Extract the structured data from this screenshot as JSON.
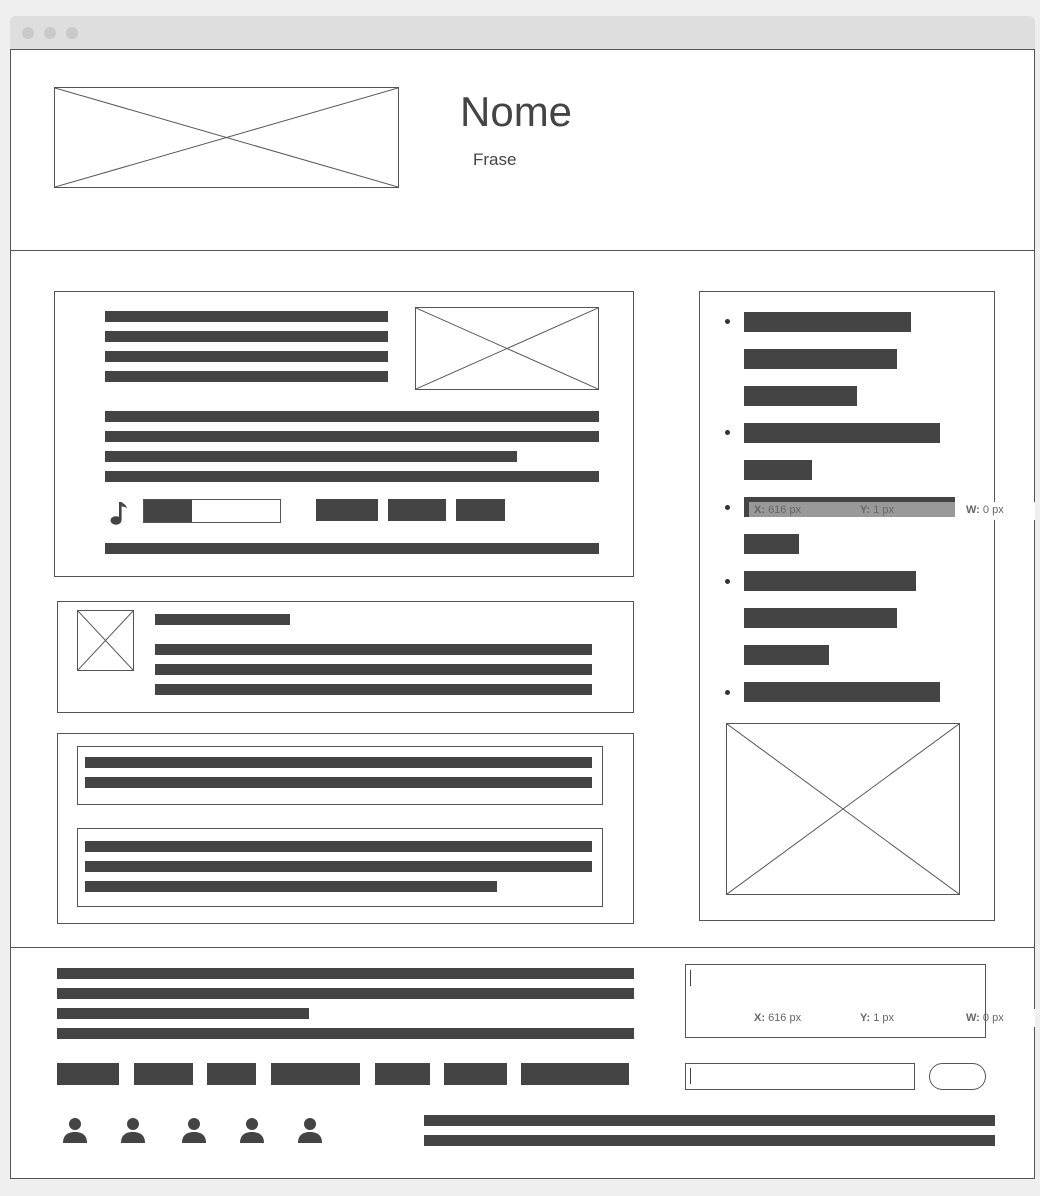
{
  "header": {
    "title": "Nome",
    "subtitle": "Frase"
  },
  "tooltip_sidebar": {
    "x_label": "X:",
    "x_value": "616 px",
    "y_label": "Y:",
    "y_value": "1 px",
    "w_label": "W:",
    "w_value": "0 px"
  },
  "tooltip_footer": {
    "x_label": "X:",
    "x_value": "616 px",
    "y_label": "Y:",
    "y_value": "1 px",
    "w_label": "W:",
    "w_value": "0 px"
  },
  "player": {
    "icon": "music-note-icon",
    "progress": 0.35
  },
  "icons": {
    "user": "user-icon",
    "placeholder": "image-placeholder-icon"
  },
  "colors": {
    "bar": "#444444",
    "border": "#555555",
    "chrome": "#dedede",
    "background": "#efefef"
  }
}
